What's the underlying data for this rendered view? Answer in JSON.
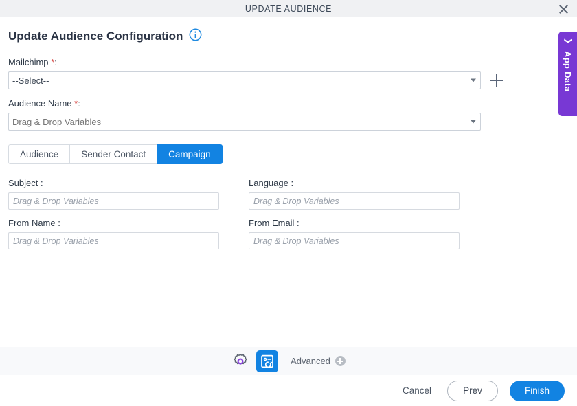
{
  "window": {
    "title": "UPDATE AUDIENCE",
    "close_icon": "close-icon"
  },
  "page": {
    "heading": "Update Audience Configuration",
    "info_icon": "info-icon"
  },
  "fields": {
    "mailchimp": {
      "label": "Mailchimp",
      "required_mark": "*",
      "colon": ":",
      "value": "--Select--",
      "add_icon": "plus-icon"
    },
    "audience_name": {
      "label": "Audience Name",
      "required_mark": "*",
      "colon": ":",
      "placeholder": "Drag & Drop Variables",
      "value": ""
    }
  },
  "tabs": [
    {
      "label": "Audience",
      "active": false
    },
    {
      "label": "Sender Contact",
      "active": false
    },
    {
      "label": "Campaign",
      "active": true
    }
  ],
  "campaign_form": {
    "subject": {
      "label": "Subject :",
      "placeholder": "Drag & Drop Variables",
      "value": ""
    },
    "language": {
      "label": "Language :",
      "placeholder": "Drag & Drop Variables",
      "value": ""
    },
    "from_name": {
      "label": "From Name :",
      "placeholder": "Drag & Drop Variables",
      "value": ""
    },
    "from_email": {
      "label": "From Email :",
      "placeholder": "Drag & Drop Variables",
      "value": ""
    }
  },
  "toolbar": {
    "settings_icon": "gear-icon",
    "form_refresh_icon": "card-refresh-icon",
    "advanced_label": "Advanced",
    "advanced_add_icon": "circle-plus-icon"
  },
  "footer": {
    "cancel_label": "Cancel",
    "prev_label": "Prev",
    "finish_label": "Finish"
  },
  "side_panel": {
    "label": "App Data",
    "collapse_icon": "chevron-left-icon"
  },
  "colors": {
    "accent_blue": "#1283e2",
    "purple": "#7838d4",
    "required_red": "#d9534f",
    "titlebar_bg": "#f0f1f3",
    "toolstrip_bg": "#f8f9fb"
  }
}
